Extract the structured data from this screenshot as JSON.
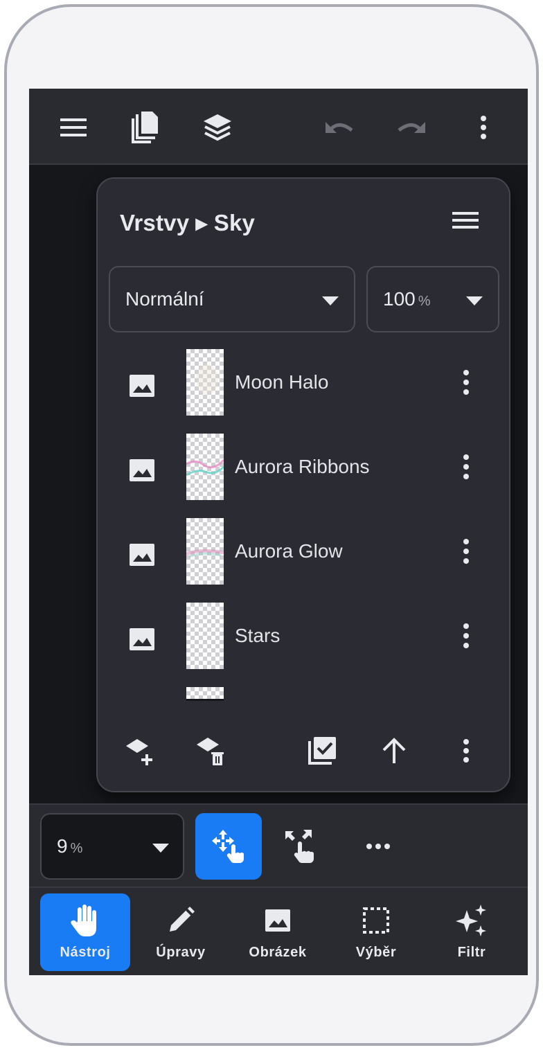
{
  "toolbar": {
    "icons": [
      "menu-icon",
      "pages-icon",
      "layers-icon",
      "undo-icon",
      "redo-icon",
      "more-vertical-icon"
    ],
    "undo_enabled": false,
    "redo_enabled": false
  },
  "layers_panel": {
    "title": "Vrstvy ▸ Sky",
    "blend_mode": "Normální",
    "opacity_value": "100",
    "opacity_unit": "%",
    "layers": [
      {
        "name": "Moon Halo",
        "type_icon": "image-icon"
      },
      {
        "name": "Aurora Ribbons",
        "type_icon": "image-icon"
      },
      {
        "name": "Aurora Glow",
        "type_icon": "image-icon"
      },
      {
        "name": "Stars",
        "type_icon": "image-icon"
      }
    ],
    "actions": [
      "add-layer-icon",
      "delete-layer-icon",
      "select-layers-icon",
      "move-up-icon",
      "more-vertical-icon"
    ]
  },
  "subbar": {
    "zoom_value": "9",
    "zoom_unit": "%",
    "tools": [
      "move-touch-icon",
      "resize-touch-icon",
      "more-horizontal-icon"
    ]
  },
  "bottom_nav": {
    "items": [
      {
        "label": "Nástroj",
        "icon": "hand-icon",
        "active": true
      },
      {
        "label": "Úpravy",
        "icon": "pencil-icon",
        "active": false
      },
      {
        "label": "Obrázek",
        "icon": "image-icon",
        "active": false
      },
      {
        "label": "Výběr",
        "icon": "selection-icon",
        "active": false
      },
      {
        "label": "Filtr",
        "icon": "sparkle-icon",
        "active": false
      }
    ]
  },
  "colors": {
    "accent": "#1a7cf5",
    "toolbar_bg": "#2a2b31",
    "panel_bg": "#2b2c33",
    "canvas_bg": "#16171b",
    "text": "#e9eaee"
  }
}
